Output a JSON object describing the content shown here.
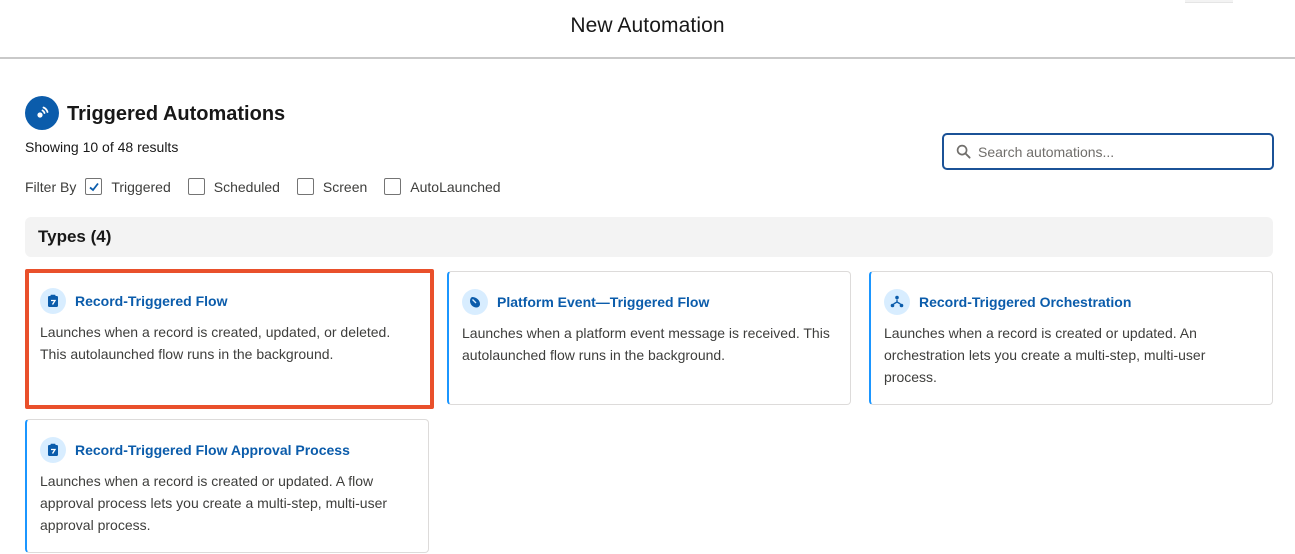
{
  "modal": {
    "title": "New Automation"
  },
  "section": {
    "title": "Triggered Automations",
    "icon": "signal-wave-icon",
    "results_text": "Showing 10 of 48 results"
  },
  "filters": {
    "label": "Filter By",
    "options": [
      {
        "label": "Triggered",
        "checked": true
      },
      {
        "label": "Scheduled",
        "checked": false
      },
      {
        "label": "Screen",
        "checked": false
      },
      {
        "label": "AutoLaunched",
        "checked": false
      }
    ]
  },
  "search": {
    "placeholder": "Search automations...",
    "value": ""
  },
  "types": {
    "header": "Types (4)",
    "cards": [
      {
        "title": "Record-Triggered Flow",
        "icon": "record-flow-icon",
        "selected": true,
        "desc_lines": [
          "Launches when a record is created, updated, or deleted.",
          "This autolaunched flow runs in the background."
        ]
      },
      {
        "title": "Platform Event—Triggered Flow",
        "icon": "platform-event-icon",
        "selected": false,
        "desc_lines": [
          "Launches when a platform event message is received. This",
          "autolaunched flow runs in the background."
        ]
      },
      {
        "title": "Record-Triggered Orchestration",
        "icon": "orchestration-icon",
        "selected": false,
        "desc_lines": [
          "Launches when a record is created or updated. An",
          "orchestration lets you create a multi-step, multi-user",
          "process."
        ]
      },
      {
        "title": "Record-Triggered Flow Approval Process",
        "icon": "record-flow-icon",
        "selected": false,
        "desc_lines": [
          "Launches when a record is created or updated. A flow",
          "approval process lets you create a multi-step, multi-user",
          "approval process."
        ]
      }
    ]
  },
  "colors": {
    "brand": "#0b5cab",
    "selected_border": "#e9502b",
    "card_accent": "#1b96ff",
    "search_border": "#1b5297"
  }
}
